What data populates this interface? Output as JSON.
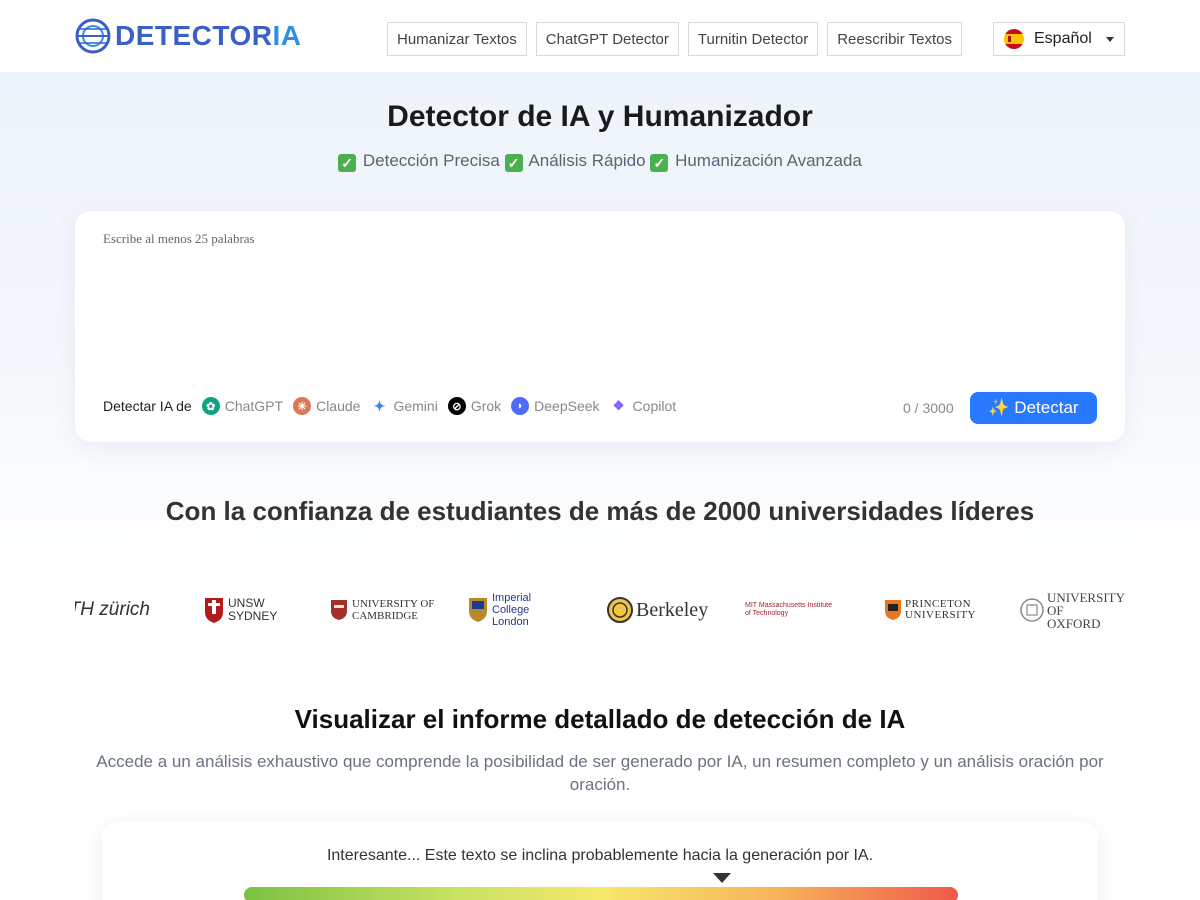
{
  "header": {
    "logo_main": "DETECTOR",
    "logo_accent": "IA",
    "nav": [
      "Humanizar Textos",
      "ChatGPT Detector",
      "Turnitin Detector",
      "Reescribir Textos"
    ],
    "language": "Español"
  },
  "hero": {
    "title": "Detector de IA y Humanizador",
    "features": [
      "Detección Precisa",
      "Análisis Rápido",
      "Humanización Avanzada"
    ]
  },
  "detector": {
    "placeholder": "Escribe al menos 25 palabras",
    "detect_label": "Detectar IA de",
    "models": [
      {
        "name": "ChatGPT",
        "color": "#10a37f"
      },
      {
        "name": "Claude",
        "color": "#d97757"
      },
      {
        "name": "Gemini",
        "color": "#4285f4"
      },
      {
        "name": "Grok",
        "color": "#000000"
      },
      {
        "name": "DeepSeek",
        "color": "#4d6bfe"
      },
      {
        "name": "Copilot",
        "color": "#7b61ff"
      }
    ],
    "counter": "0 / 3000",
    "button": "✨ Detectar"
  },
  "trust": {
    "title": "Con la confianza de estudiantes de más de 2000 universidades líderes",
    "universities": [
      "ETH zürich",
      "UNSW SYDNEY",
      "UNIVERSITY OF CAMBRIDGE",
      "Imperial College London",
      "Berkeley",
      "MIT Massachusetts Institute of Technology",
      "PRINCETON UNIVERSITY",
      "UNIVERSITY OF OXFORD"
    ]
  },
  "report": {
    "title": "Visualizar el informe detallado de detección de IA",
    "description": "Accede a un análisis exhaustivo que comprende la posibilidad de ser generado por IA, un resumen completo y un análisis oración por oración.",
    "verdict": "Interesante... Este texto se inclina probablemente hacia la generación por IA.",
    "gauge_level": 0.67
  },
  "colors": {
    "brand": "#3a5fc6",
    "accent": "#2979ff"
  }
}
